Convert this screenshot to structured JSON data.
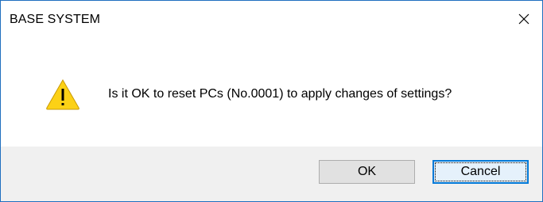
{
  "dialog": {
    "title": "BASE SYSTEM",
    "message": "Is it OK to reset PCs (No.0001) to apply changes of settings?",
    "icon": "warning-icon",
    "buttons": {
      "ok_label": "OK",
      "cancel_label": "Cancel"
    },
    "default_button": "Cancel"
  },
  "colors": {
    "window_border": "#1f6fbf",
    "footer_background": "#f0f0f0",
    "warning_fill": "#fcd116",
    "focus_border": "#0078d7"
  }
}
